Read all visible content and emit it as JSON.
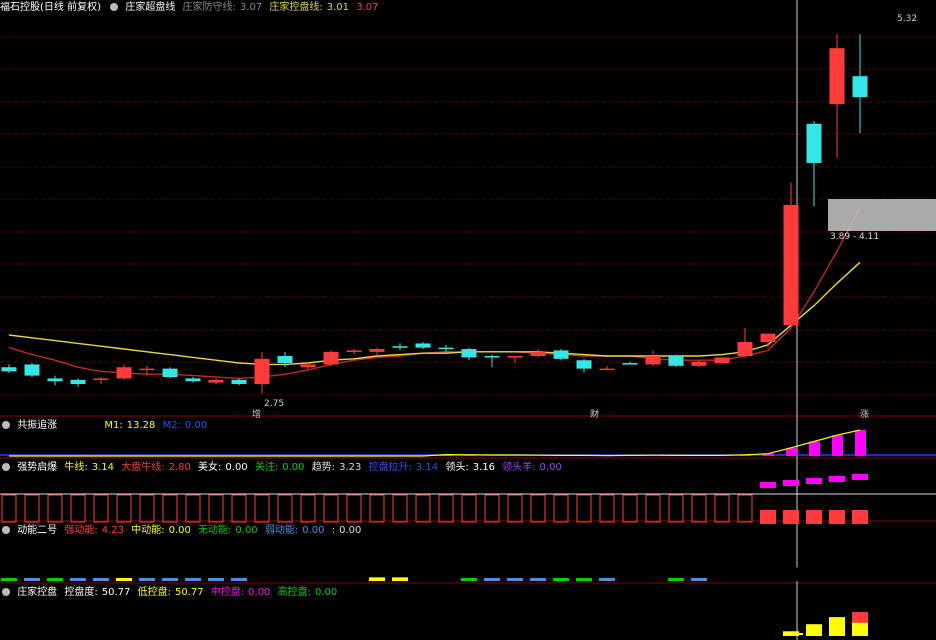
{
  "colors": {
    "up": "#ff3b3b",
    "down": "#36e6e6",
    "ma_yellow": "#e6d83a",
    "ma_red": "#c02828",
    "grid": "#5a0000",
    "green": "#00d000",
    "blue": "#4a8fe0",
    "yellow": "#ffff00",
    "magenta": "#ff00ff"
  },
  "main": {
    "title": "福石控股(日线 前复权)",
    "indicator_name": "庄家超盘线",
    "guard_label": "庄家防守线:",
    "guard_value": "3.07",
    "control_label": "庄家控盘线:",
    "control_value": "3.01",
    "extra_value": "3.07",
    "high_label": "5.32",
    "low_label": "2.75",
    "zone_label": "3.89 - 4.11",
    "marker_increase": "增",
    "marker_finance": "财",
    "marker_up": "涨"
  },
  "panel1": {
    "name": "共振追涨",
    "m1_label": "M1:",
    "m1_value": "13.28",
    "m2_label": "M2:",
    "m2_value": "0.00"
  },
  "panel2": {
    "name": "强势启爆",
    "items": [
      {
        "label": "牛线:",
        "value": "3.14"
      },
      {
        "label": "大盘牛线:",
        "value": "2.80"
      },
      {
        "label": "美女:",
        "value": "0.00"
      },
      {
        "label": "关注:",
        "value": "0.00"
      },
      {
        "label": "趋势:",
        "value": "3.23"
      },
      {
        "label": "控盘拉升:",
        "value": "3.14"
      },
      {
        "label": "领头:",
        "value": "3.16"
      },
      {
        "label": "领头羊:",
        "value": "0.00"
      }
    ]
  },
  "panel3": {
    "name": "动能二号",
    "items": [
      {
        "label": "强动能:",
        "value": "4.23"
      },
      {
        "label": "中动能:",
        "value": "0.00"
      },
      {
        "label": "无动能:",
        "value": "0.00"
      },
      {
        "label": "弱动能:",
        "value": "0.00"
      },
      {
        "label": ":",
        "value": "0.00"
      }
    ]
  },
  "panel4": {
    "name": "庄家控盘",
    "items": [
      {
        "label": "控盘度:",
        "value": "50.77"
      },
      {
        "label": "低控盘:",
        "value": "50.77"
      },
      {
        "label": "中控盘:",
        "value": "0.00"
      },
      {
        "label": "高控盘:",
        "value": "0.00"
      }
    ]
  },
  "chart_data": {
    "type": "candlestick",
    "ohlc": [
      {
        "o": 2.94,
        "h": 2.96,
        "l": 2.9,
        "c": 2.91
      },
      {
        "o": 2.96,
        "h": 2.97,
        "l": 2.87,
        "c": 2.88
      },
      {
        "o": 2.86,
        "h": 2.88,
        "l": 2.81,
        "c": 2.84
      },
      {
        "o": 2.85,
        "h": 2.86,
        "l": 2.8,
        "c": 2.82
      },
      {
        "o": 2.85,
        "h": 2.87,
        "l": 2.82,
        "c": 2.86
      },
      {
        "o": 2.86,
        "h": 2.96,
        "l": 2.85,
        "c": 2.94
      },
      {
        "o": 2.92,
        "h": 2.95,
        "l": 2.88,
        "c": 2.93
      },
      {
        "o": 2.93,
        "h": 2.94,
        "l": 2.86,
        "c": 2.87
      },
      {
        "o": 2.86,
        "h": 2.87,
        "l": 2.83,
        "c": 2.84
      },
      {
        "o": 2.83,
        "h": 2.86,
        "l": 2.82,
        "c": 2.85
      },
      {
        "o": 2.85,
        "h": 2.86,
        "l": 2.81,
        "c": 2.82
      },
      {
        "o": 2.82,
        "h": 3.05,
        "l": 2.75,
        "c": 3.0
      },
      {
        "o": 3.02,
        "h": 3.05,
        "l": 2.94,
        "c": 2.97
      },
      {
        "o": 2.94,
        "h": 2.97,
        "l": 2.92,
        "c": 2.96
      },
      {
        "o": 2.96,
        "h": 3.06,
        "l": 2.95,
        "c": 3.05
      },
      {
        "o": 3.05,
        "h": 3.07,
        "l": 3.03,
        "c": 3.06
      },
      {
        "o": 3.05,
        "h": 3.08,
        "l": 3.02,
        "c": 3.07
      },
      {
        "o": 3.09,
        "h": 3.11,
        "l": 3.06,
        "c": 3.08
      },
      {
        "o": 3.11,
        "h": 3.12,
        "l": 3.07,
        "c": 3.08
      },
      {
        "o": 3.08,
        "h": 3.1,
        "l": 3.05,
        "c": 3.07
      },
      {
        "o": 3.07,
        "h": 3.08,
        "l": 2.99,
        "c": 3.01
      },
      {
        "o": 3.02,
        "h": 3.03,
        "l": 2.94,
        "c": 3.01
      },
      {
        "o": 3.02,
        "h": 3.02,
        "l": 2.97,
        "c": 3.02
      },
      {
        "o": 3.02,
        "h": 3.07,
        "l": 3.01,
        "c": 3.05
      },
      {
        "o": 3.06,
        "h": 3.07,
        "l": 2.99,
        "c": 3.0
      },
      {
        "o": 2.99,
        "h": 3.0,
        "l": 2.9,
        "c": 2.93
      },
      {
        "o": 2.92,
        "h": 2.95,
        "l": 2.92,
        "c": 2.93
      },
      {
        "o": 2.97,
        "h": 2.98,
        "l": 2.96,
        "c": 2.96
      },
      {
        "o": 2.96,
        "h": 3.06,
        "l": 2.95,
        "c": 3.02
      },
      {
        "o": 3.02,
        "h": 3.03,
        "l": 2.94,
        "c": 2.95
      },
      {
        "o": 2.95,
        "h": 2.99,
        "l": 2.94,
        "c": 2.98
      },
      {
        "o": 2.97,
        "h": 3.01,
        "l": 2.96,
        "c": 3.01
      },
      {
        "o": 3.02,
        "h": 3.22,
        "l": 3.01,
        "c": 3.12
      },
      {
        "o": 3.12,
        "h": 3.18,
        "l": 3.08,
        "c": 3.18
      },
      {
        "o": 3.24,
        "h": 4.26,
        "l": 3.24,
        "c": 4.1
      },
      {
        "o": 4.68,
        "h": 4.7,
        "l": 4.09,
        "c": 4.4
      },
      {
        "o": 4.82,
        "h": 5.32,
        "l": 4.44,
        "c": 5.22
      },
      {
        "o": 5.02,
        "h": 5.32,
        "l": 4.61,
        "c": 4.87
      }
    ],
    "ma_yellow": [
      3.17,
      3.15,
      3.13,
      3.11,
      3.09,
      3.07,
      3.05,
      3.03,
      3.01,
      2.99,
      2.97,
      2.96,
      2.96,
      2.97,
      2.99,
      3.0,
      3.02,
      3.03,
      3.04,
      3.04,
      3.05,
      3.05,
      3.05,
      3.05,
      3.04,
      3.03,
      3.02,
      3.02,
      3.02,
      3.02,
      3.02,
      3.03,
      3.05,
      3.1,
      3.24,
      3.38,
      3.54,
      3.69
    ],
    "ma_red": [
      3.08,
      3.03,
      2.99,
      2.94,
      2.91,
      2.9,
      2.89,
      2.89,
      2.88,
      2.87,
      2.86,
      2.87,
      2.89,
      2.92,
      2.96,
      2.99,
      3.01,
      3.02,
      3.04,
      3.05,
      3.05,
      3.05,
      3.05,
      3.04,
      3.03,
      3.02,
      3.02,
      3.02,
      3.0,
      2.99,
      2.99,
      2.99,
      3.02,
      3.06,
      3.22,
      3.48,
      3.77,
      4.08
    ],
    "ylim": [
      2.62,
      5.45
    ],
    "panel1_m1": [
      0,
      0,
      0,
      0,
      0,
      0,
      0,
      0,
      0,
      0,
      0,
      0,
      0,
      0,
      0,
      0,
      0,
      0,
      0,
      0.7,
      0.6,
      0.5,
      0.5,
      0.4,
      0.3,
      0.3,
      0.2,
      0.3,
      0.4,
      0.3,
      0.3,
      0.3,
      0.6,
      1.2,
      4.2,
      7.4,
      10.6,
      13.28
    ],
    "panel2_bars": [
      1,
      1,
      1,
      1,
      1,
      1,
      1,
      1,
      1,
      1,
      1,
      1,
      1,
      1,
      1,
      1,
      1,
      1,
      1,
      1,
      1,
      1,
      1,
      1,
      1,
      1,
      1,
      1,
      1,
      1,
      1,
      1,
      1,
      1,
      1,
      1,
      1,
      1
    ],
    "panel3_values": [
      0.2,
      0.2,
      0.2,
      0.2,
      0.2,
      0.2,
      0.2,
      0.2,
      0.2,
      0.2,
      0.2,
      0.2,
      0.25,
      0.25,
      0.3,
      0.3,
      0.35,
      0.35,
      0.3,
      0.25,
      0.2,
      0.2,
      0.2,
      0.2,
      0.2,
      0.2,
      0.3,
      0.25,
      0.25,
      0.2,
      0.2,
      0.3,
      0.45,
      0.6,
      1.3,
      2.6,
      3.7,
      4.23
    ],
    "panel3_colors": [
      "green",
      "blue",
      "green",
      "blue",
      "blue",
      "yellow",
      "blue",
      "blue",
      "blue",
      "blue",
      "blue",
      "red",
      "red",
      "red",
      "red",
      "red",
      "yellow",
      "yellow",
      "red",
      "red",
      "green",
      "blue",
      "blue",
      "blue",
      "green",
      "green",
      "blue",
      "red",
      "red",
      "green",
      "blue",
      "red",
      "red",
      "red",
      "red",
      "red",
      "red",
      "red"
    ],
    "panel4_values": [
      0,
      0,
      0,
      0,
      0,
      0,
      0,
      0,
      0,
      0,
      0,
      0,
      0,
      0,
      0,
      0,
      0,
      0,
      0,
      0,
      0,
      0,
      0,
      0,
      0,
      0,
      0,
      0,
      0,
      0,
      0,
      0,
      0,
      0,
      10,
      25,
      40,
      50.77
    ]
  }
}
